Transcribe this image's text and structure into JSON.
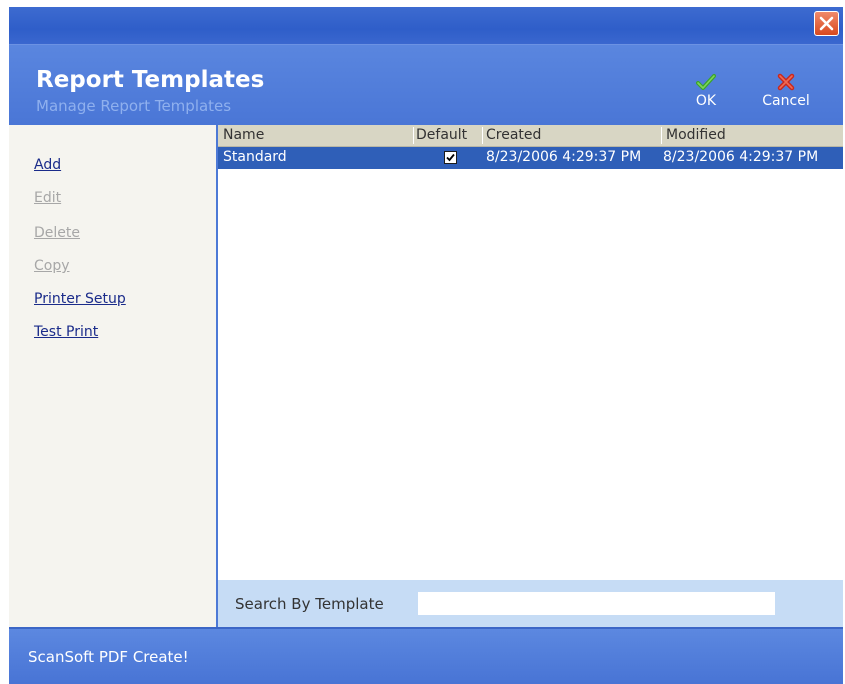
{
  "window": {
    "close_icon": "close-icon"
  },
  "header": {
    "title": "Report Templates",
    "subtitle": "Manage Report Templates",
    "ok_label": "OK",
    "cancel_label": "Cancel"
  },
  "sidebar": {
    "items": [
      {
        "label": "Add",
        "enabled": true
      },
      {
        "label": "Edit",
        "enabled": false
      },
      {
        "label": "Delete",
        "enabled": false
      },
      {
        "label": "Copy",
        "enabled": false
      },
      {
        "label": "Printer Setup",
        "enabled": true
      },
      {
        "label": "Test Print",
        "enabled": true
      }
    ]
  },
  "table": {
    "columns": [
      "Name",
      "Default",
      "Created",
      "Modified"
    ],
    "rows": [
      {
        "name": "Standard",
        "default": true,
        "created": "8/23/2006 4:29:37 PM",
        "modified": "8/23/2006 4:29:37 PM"
      }
    ]
  },
  "search": {
    "label": "Search By Template",
    "value": ""
  },
  "footer": {
    "text": "ScanSoft PDF Create!"
  },
  "colors": {
    "brand_blue": "#4d79d6",
    "selection": "#2f5fb8",
    "search_bg": "#c6dcf5",
    "close_red": "#d9491f"
  }
}
